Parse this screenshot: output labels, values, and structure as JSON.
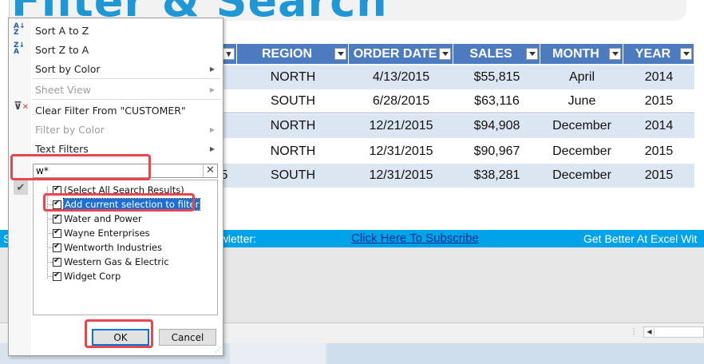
{
  "page_title": "Filter & Search",
  "headers": [
    "REGION",
    "ORDER DATE",
    "SALES",
    "MONTH",
    "YEAR"
  ],
  "rows": [
    [
      "NORTH",
      "4/13/2015",
      "$55,815",
      "April",
      "2014"
    ],
    [
      "SOUTH",
      "6/28/2015",
      "$63,116",
      "June",
      "2015"
    ],
    [
      "NORTH",
      "12/21/2015",
      "$94,908",
      "December",
      "2014"
    ],
    [
      "NORTH",
      "12/31/2015",
      "$90,967",
      "December",
      "2015"
    ],
    [
      "SOUTH",
      "12/31/2015",
      "$38,281",
      "December",
      "2015"
    ]
  ],
  "partial_cell_fragment": "5",
  "menu": {
    "sort_a_z": "Sort A to Z",
    "sort_z_a": "Sort Z to A",
    "sort_by_color": "Sort by Color",
    "sheet_view": "Sheet View",
    "clear_filter": "Clear Filter From \"CUSTOMER\"",
    "filter_by_color": "Filter by Color",
    "text_filters": "Text Filters"
  },
  "search": {
    "value": "w*"
  },
  "list_items": [
    {
      "label": "(Select All Search Results)",
      "checked": true
    },
    {
      "label": "Add current selection to filter",
      "checked": true,
      "selected": true
    },
    {
      "label": "Water and Power",
      "checked": true
    },
    {
      "label": "Wayne Enterprises",
      "checked": true
    },
    {
      "label": "Wentworth Industries",
      "checked": true
    },
    {
      "label": "Western Gas & Electric",
      "checked": true
    },
    {
      "label": "Widget Corp",
      "checked": true
    }
  ],
  "buttons": {
    "ok": "OK",
    "cancel": "Cancel"
  },
  "newsletter": {
    "prefix": "S",
    "label": "ewletter:",
    "link": "Click Here To Subscribe",
    "tagline": "Get Better At Excel Wit"
  },
  "colors": {
    "header_blue": "#4c7cbf",
    "row_shade": "#dce6f2",
    "newsletter_bar": "#00a2e8",
    "title_blue": "#1f97d4",
    "highlight_red": "#e8464d"
  }
}
